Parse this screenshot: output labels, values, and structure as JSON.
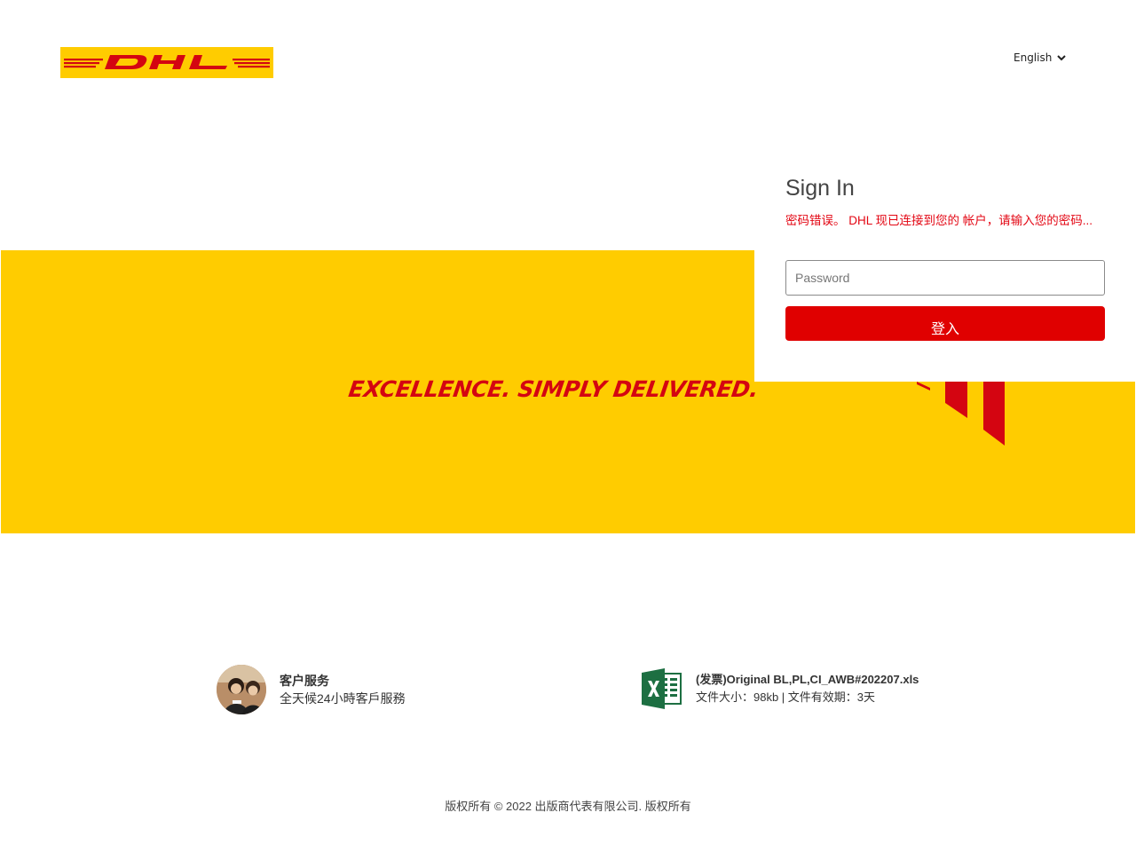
{
  "header": {
    "logo_text": "DHL",
    "language": "English"
  },
  "hero": {
    "tagline": "EXCELLENCE. SIMPLY DELIVERED."
  },
  "signin": {
    "title": "Sign In",
    "error_message": "密码错误。 DHL 现已连接到您的 帐户，请输入您的密码...",
    "password_placeholder": "Password",
    "login_label": "登入"
  },
  "customer_service": {
    "title": "客户服务",
    "subtitle": "全天候24小時客戶服務"
  },
  "attachment": {
    "filename": "(发票)Original BL,PL,CI_AWB#202207.xls",
    "meta": "文件大小：98kb | 文件有效期：3天"
  },
  "footer": {
    "copyright": "版权所有 © 2022 出版商代表有限公司. 版权所有"
  },
  "colors": {
    "dhl_yellow": "#ffcc00",
    "dhl_red": "#d40511",
    "button_red": "#e00000",
    "excel_green": "#1d6f42"
  }
}
